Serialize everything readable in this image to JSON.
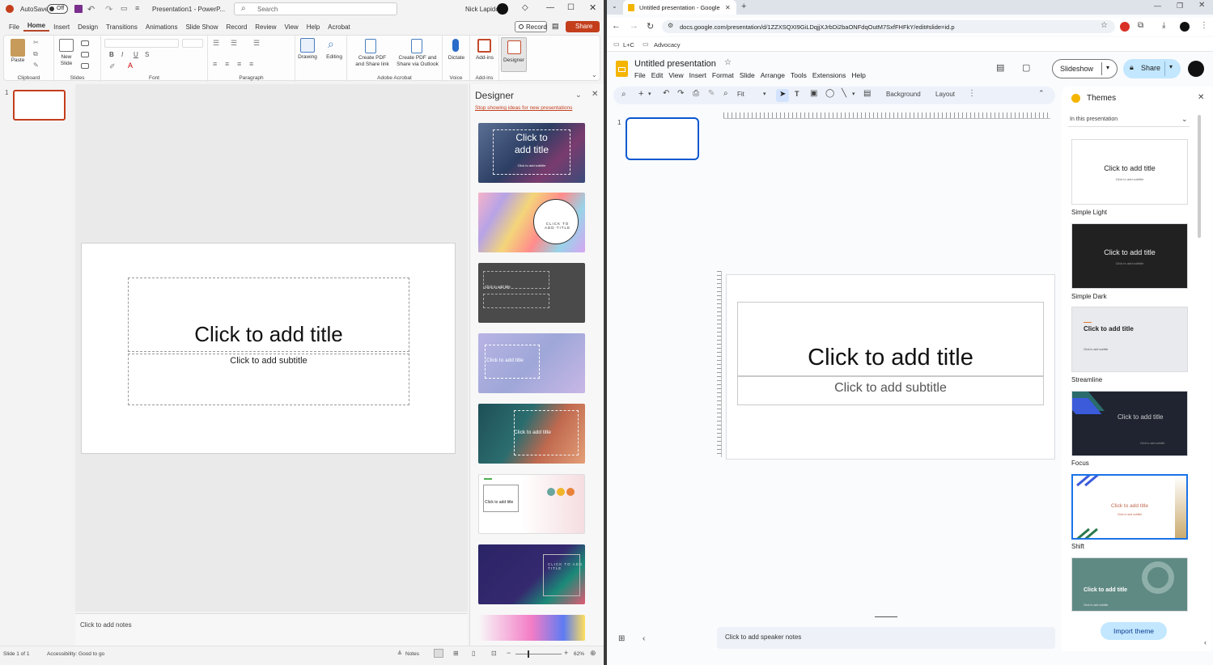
{
  "ppt": {
    "title_bar": {
      "autosave_label": "AutoSave",
      "autosave_state": "Off",
      "filename": "Presentation1 - PowerP...",
      "search_placeholder": "Search",
      "user_name": "Nick Lapido"
    },
    "menu_tabs": [
      "File",
      "Home",
      "Insert",
      "Design",
      "Transitions",
      "Animations",
      "Slide Show",
      "Record",
      "Review",
      "View",
      "Help",
      "Acrobat"
    ],
    "record_label": "Record",
    "share_label": "Share",
    "ribbon": {
      "paste": "Paste",
      "clipboard": "Clipboard",
      "new_slide_1": "New",
      "new_slide_2": "Slide",
      "slides": "Slides",
      "bold": "B",
      "italic": "I",
      "underline": "U",
      "strike": "S",
      "font": "Font",
      "paragraph": "Paragraph",
      "drawing": "Drawing",
      "editing": "Editing",
      "create_pdf_1": "Create PDF",
      "create_pdf_2": "and Share link",
      "create_pdf_outlook_1": "Create PDF and",
      "create_pdf_outlook_2": "Share via Outlook",
      "adobe": "Adobe Acrobat",
      "dictate": "Dictate",
      "voice": "Voice",
      "addins": "Add-ins",
      "addins_group": "Add-ins",
      "designer": "Designer"
    },
    "slide_number": "1",
    "slide": {
      "title": "Click to add title",
      "subtitle": "Click to add subtitle"
    },
    "notes_placeholder": "Click to add notes",
    "designer": {
      "title": "Designer",
      "stop_link": "Stop showing ideas for new presentations",
      "thumb1_title": "Click to add title",
      "thumb1_sub": "Click to add subtitle",
      "thumb2_title": "CLICK TO ADD TITLE",
      "thumb3_title": "Click to add title",
      "thumb4_title": "Click to add title",
      "thumb5_title": "Click to add title",
      "thumb6_title": "Click to add title",
      "thumb7_title": "CLICK TO ADD TITLE"
    },
    "status": {
      "slide_of": "Slide 1 of 1",
      "accessibility": "Accessibility: Good to go",
      "notes": "Notes",
      "zoom": "62%"
    }
  },
  "gs": {
    "tab_title": "Untitled presentation - Google",
    "url": "docs.google.com/presentation/d/1ZZXSQXI9GiLDqjjXJrbDi2baONFdqOutM7SxfFHFkY/edit#slide=id.p",
    "bookmarks": [
      "L+C",
      "Advocacy"
    ],
    "doc_title": "Untitled presentation",
    "menus": [
      "File",
      "Edit",
      "View",
      "Insert",
      "Format",
      "Slide",
      "Arrange",
      "Tools",
      "Extensions",
      "Help"
    ],
    "slideshow": "Slideshow",
    "share": "Share",
    "toolbar": {
      "zoom": "Fit",
      "background": "Background",
      "layout": "Layout"
    },
    "slide_number": "1",
    "slide": {
      "title": "Click to add title",
      "subtitle": "Click to add subtitle"
    },
    "notes_placeholder": "Click to add speaker notes",
    "themes": {
      "title": "Themes",
      "filter": "In this presentation",
      "import": "Import theme",
      "items": [
        {
          "name": "Simple Light",
          "title": "Click to add title",
          "sub": "Click to add subtitle"
        },
        {
          "name": "Simple Dark",
          "title": "Click to add title",
          "sub": "Click to add subtitle"
        },
        {
          "name": "Streamline",
          "title": "Click to add title",
          "sub": "Click to add subtitle"
        },
        {
          "name": "Focus",
          "title": "Click to add title",
          "sub": "Click to add subtitle"
        },
        {
          "name": "Shift",
          "title": "Click to add title",
          "sub": "Click to add subtitle"
        },
        {
          "name": "",
          "title": "Click to add title",
          "sub": "Click to add subtitle"
        }
      ]
    }
  },
  "colors": {
    "ppt_accent": "#b7472a",
    "share_red": "#c43e1c",
    "gs_blue": "#0b57d0",
    "slides_yellow": "#f4b400"
  }
}
